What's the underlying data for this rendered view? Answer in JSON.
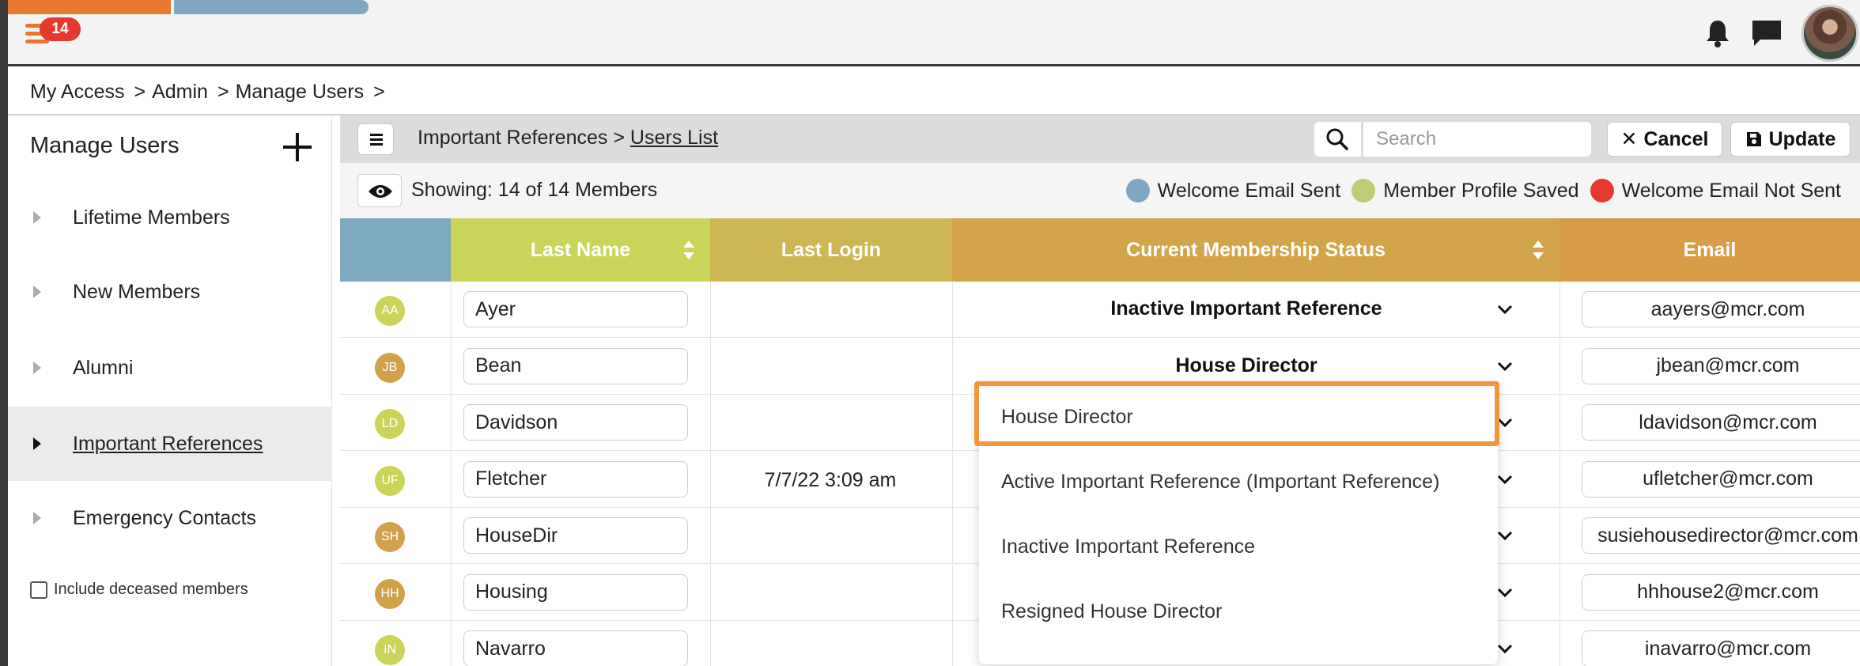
{
  "topbar": {
    "notification_count": "14",
    "icons": [
      "menu-icon",
      "bell-icon",
      "chat-icon",
      "avatar"
    ],
    "accent_orange": "#e8782e",
    "accent_blue": "#7fa6c3",
    "badge_red": "#e53a2f"
  },
  "breadcrumb": {
    "items": [
      "My Access",
      "Admin",
      "Manage Users"
    ],
    "separator": ">"
  },
  "sidebar": {
    "title": "Manage Users",
    "items": [
      {
        "label": "Lifetime Members"
      },
      {
        "label": "New Members"
      },
      {
        "label": "Alumni"
      },
      {
        "label": "Important References"
      },
      {
        "label": "Emergency Contacts"
      }
    ],
    "active_item": "Important References",
    "deceased_label": "Include deceased members"
  },
  "panel": {
    "crumb_parent": "Important References >",
    "crumb_current": "Users List",
    "search_placeholder": "Search",
    "cancel_label": "Cancel",
    "update_label": "Update",
    "showing": "Showing: 14 of 14 Members"
  },
  "legend": [
    {
      "label": "Welcome Email Sent",
      "color": "#7fa6c3"
    },
    {
      "label": "Member Profile Saved",
      "color": "#bccd73"
    },
    {
      "label": "Welcome Email Not Sent",
      "color": "#e53a2f"
    }
  ],
  "table": {
    "columns": [
      "Last Name",
      "Last Login",
      "Current Membership Status",
      "Email"
    ],
    "column_colors": {
      "select": "#7ea9c0",
      "last_name": "#c9d459",
      "last_login": "#cdb653",
      "status": "#d3a54a",
      "email": "#d99c47"
    },
    "rows": [
      {
        "initials": "AA",
        "initials_color": "#c9d459",
        "last_name": "Ayer",
        "last_login": "",
        "status": "Inactive Important Reference",
        "email": "aayers@mcr.com"
      },
      {
        "initials": "JB",
        "initials_color": "#d1a14b",
        "last_name": "Bean",
        "last_login": "",
        "status": "House Director",
        "email": "jbean@mcr.com"
      },
      {
        "initials": "LD",
        "initials_color": "#c9d459",
        "last_name": "Davidson",
        "last_login": "",
        "status": "",
        "email": "ldavidson@mcr.com"
      },
      {
        "initials": "UF",
        "initials_color": "#c9d459",
        "last_name": "Fletcher",
        "last_login": "7/7/22 3:09 am",
        "status": "",
        "email": "ufletcher@mcr.com"
      },
      {
        "initials": "SH",
        "initials_color": "#d1a14b",
        "last_name": "HouseDir",
        "last_login": "",
        "status": "",
        "email": "susiehousedirector@mcr.com"
      },
      {
        "initials": "HH",
        "initials_color": "#d1a14b",
        "last_name": "Housing",
        "last_login": "",
        "status": "",
        "email": "hhhouse2@mcr.com"
      },
      {
        "initials": "IN",
        "initials_color": "#c9d459",
        "last_name": "Navarro",
        "last_login": "",
        "status": "",
        "email": "inavarro@mcr.com"
      }
    ]
  },
  "dropdown": {
    "options": [
      "House Director",
      "Active Important Reference (Important Reference)",
      "Inactive Important Reference",
      "Resigned House Director"
    ],
    "highlighted": "House Director",
    "highlight_color": "#f0963c"
  }
}
